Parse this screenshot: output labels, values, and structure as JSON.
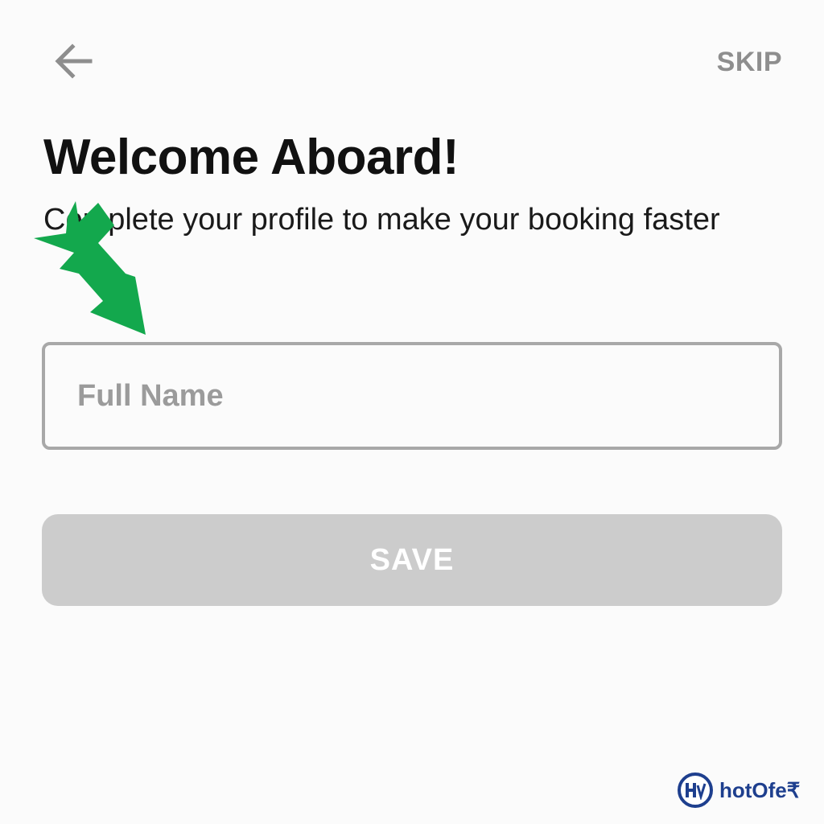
{
  "header": {
    "back_icon": "arrow-left-icon",
    "skip_label": "SKIP"
  },
  "main": {
    "title": "Welcome Aboard!",
    "subtitle": "Complete your profile to make your booking faster",
    "name_field": {
      "placeholder": "Full Name",
      "value": ""
    },
    "save_label": "SAVE"
  },
  "annotation": {
    "icon": "green-arrow-icon",
    "color": "#13a84d"
  },
  "watermark": {
    "logo_icon": "hotofer-logo-icon",
    "name": "hotOfe₹"
  },
  "colors": {
    "disabled_button": "#cccccc",
    "input_border": "#a8a8a8",
    "muted_text": "#8e8e8e",
    "brand": "#1e3f8e"
  }
}
